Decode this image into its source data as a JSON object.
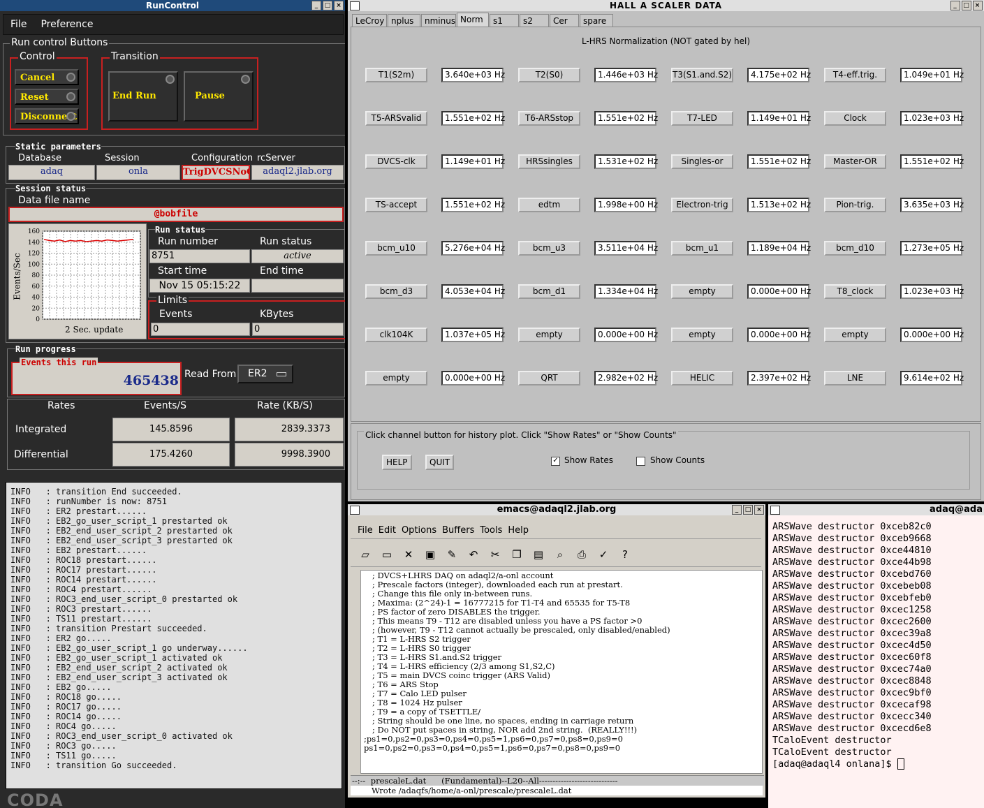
{
  "runcontrol": {
    "title": "RunControl",
    "menu": [
      "File",
      "Preference"
    ],
    "run_control_buttons": "Run control Buttons",
    "control_label": "Control",
    "control_buttons": [
      "Cancel",
      "Reset",
      "Disconnect"
    ],
    "transition_label": "Transition",
    "transition_buttons": [
      "End Run",
      "Pause"
    ],
    "static_params": {
      "title": "Static parameters",
      "database_label": "Database",
      "database": "adaq",
      "session_label": "Session",
      "session": "onla",
      "config_label": "Configuration",
      "config": "TrigDVCSNoC",
      "rcserver_label": "rcServer",
      "rcserver": "adaql2.jlab.org"
    },
    "session_status": {
      "title": "Session status",
      "data_file_label": "Data file name",
      "data_file": "@bobfile"
    },
    "plot": {
      "ylabel": "Events/Sec",
      "xlabel": "2 Sec. update",
      "y_ticks": [
        "160",
        "140",
        "120",
        "100",
        "80",
        "60",
        "40",
        "20",
        "0"
      ],
      "ylim": [
        0,
        160
      ],
      "series_values": [
        145,
        143,
        142,
        144,
        141,
        143,
        142,
        143,
        141,
        142,
        143,
        142,
        144,
        143,
        142,
        143,
        144,
        145
      ]
    },
    "run_status": {
      "title": "Run status",
      "run_number_label": "Run number",
      "run_number": "8751",
      "run_status_label": "Run status",
      "run_status": "active",
      "start_time_label": "Start time",
      "start_time": "Nov 15 05:15:22",
      "end_time_label": "End time",
      "end_time": "",
      "limits_label": "Limits",
      "events_label": "Events",
      "events": "0",
      "kbytes_label": "KBytes",
      "kbytes": "0"
    },
    "run_progress": {
      "title": "Run progress",
      "events_label": "Events this run",
      "events": "465438",
      "read_from_label": "Read From:",
      "read_from": "ER2"
    },
    "rates": {
      "rates_label": "Rates",
      "events_label": "Events/S",
      "rate_label": "Rate (KB/S)",
      "integrated_label": "Integrated",
      "integrated_events": "145.8596",
      "integrated_rate": "2839.3373",
      "differential_label": "Differential",
      "differential_events": "175.4260",
      "differential_rate": "9998.3900"
    },
    "log": [
      "INFO   : transition End succeeded.",
      "INFO   : runNumber is now: 8751",
      "INFO   : ER2 prestart......",
      "INFO   : EB2_go_user_script_1 prestarted ok",
      "INFO   : EB2_end_user_script_2 prestarted ok",
      "INFO   : EB2_end_user_script_3 prestarted ok",
      "INFO   : EB2 prestart......",
      "INFO   : ROC18 prestart......",
      "INFO   : ROC17 prestart......",
      "INFO   : ROC14 prestart......",
      "INFO   : ROC4 prestart......",
      "INFO   : ROC3_end_user_script_0 prestarted ok",
      "INFO   : ROC3 prestart......",
      "INFO   : TS11 prestart......",
      "INFO   : transition Prestart succeeded.",
      "INFO   : ER2 go.....",
      "INFO   : EB2_go_user_script_1 go underway......",
      "INFO   : EB2_go_user_script_1 activated ok",
      "INFO   : EB2_end_user_script_2 activated ok",
      "INFO   : EB2_end_user_script_3 activated ok",
      "INFO   : EB2 go.....",
      "INFO   : ROC18 go.....",
      "INFO   : ROC17 go.....",
      "INFO   : ROC14 go.....",
      "INFO   : ROC4 go.....",
      "INFO   : ROC3_end_user_script_0 activated ok",
      "INFO   : ROC3 go.....",
      "INFO   : TS11 go.....",
      "INFO   : transition Go succeeded."
    ],
    "logo": "CODA"
  },
  "scaler": {
    "title": "HALL  A  SCALER  DATA",
    "tabs": [
      "LeCroy",
      "nplus",
      "nminus",
      "Norm",
      "s1",
      "s2",
      "Cer",
      "spare"
    ],
    "selected_tab": "Norm",
    "heading": "L-HRS Normalization (NOT gated by hel)",
    "rows": [
      [
        [
          "T1(S2m)",
          "3.640e+03 Hz"
        ],
        [
          "T2(S0)",
          "1.446e+03 Hz"
        ],
        [
          "T3(S1.and.S2)",
          "4.175e+02 Hz"
        ],
        [
          "T4-eff.trig.",
          "1.049e+01 Hz"
        ]
      ],
      [
        [
          "T5-ARSvalid",
          "1.551e+02 Hz"
        ],
        [
          "T6-ARSstop",
          "1.551e+02 Hz"
        ],
        [
          "T7-LED",
          "1.149e+01 Hz"
        ],
        [
          "Clock",
          "1.023e+03 Hz"
        ]
      ],
      [
        [
          "DVCS-clk",
          "1.149e+01 Hz"
        ],
        [
          "HRSsingles",
          "1.531e+02 Hz"
        ],
        [
          "Singles-or",
          "1.551e+02 Hz"
        ],
        [
          "Master-OR",
          "1.551e+02 Hz"
        ]
      ],
      [
        [
          "TS-accept",
          "1.551e+02 Hz"
        ],
        [
          "edtm",
          "1.998e+00 Hz"
        ],
        [
          "Electron-trig",
          "1.513e+02 Hz"
        ],
        [
          "Pion-trig.",
          "3.635e+03 Hz"
        ]
      ],
      [
        [
          "bcm_u10",
          "5.276e+04 Hz"
        ],
        [
          "bcm_u3",
          "3.511e+04 Hz"
        ],
        [
          "bcm_u1",
          "1.189e+04 Hz"
        ],
        [
          "bcm_d10",
          "1.273e+05 Hz"
        ]
      ],
      [
        [
          "bcm_d3",
          "4.053e+04 Hz"
        ],
        [
          "bcm_d1",
          "1.334e+04 Hz"
        ],
        [
          "empty",
          "0.000e+00 Hz"
        ],
        [
          "T8_clock",
          "1.023e+03 Hz"
        ]
      ],
      [
        [
          "clk104K",
          "1.037e+05 Hz"
        ],
        [
          "empty",
          "0.000e+00 Hz"
        ],
        [
          "empty",
          "0.000e+00 Hz"
        ],
        [
          "empty",
          "0.000e+00 Hz"
        ]
      ],
      [
        [
          "empty",
          "0.000e+00 Hz"
        ],
        [
          "QRT",
          "2.982e+02 Hz"
        ],
        [
          "HELIC",
          "2.397e+02 Hz"
        ],
        [
          "LNE",
          "9.614e+02 Hz"
        ]
      ]
    ],
    "footer_text": "Click channel button for history plot.  Click \"Show Rates\" or \"Show Counts\"",
    "help_label": "HELP",
    "quit_label": "QUIT",
    "show_rates_label": "Show Rates",
    "show_rates_checked": true,
    "show_counts_label": "Show Counts",
    "show_counts_checked": false
  },
  "emacs": {
    "title": "emacs@adaql2.jlab.org",
    "menu": [
      "File",
      "Edit",
      "Options",
      "Buffers",
      "Tools",
      "Help"
    ],
    "lines": [
      "; DVCS+LHRS DAQ on adaql2/a-onl account",
      "; Prescale factors (integer), downloaded each run at prestart.",
      "; Change this file only in-between runs.",
      "; Maxima: (2^24)-1 = 16777215 for T1-T4 and 65535 for T5-T8",
      "; PS factor of zero DISABLES the trigger.",
      "; This means T9 - T12 are disabled unless you have a PS factor >0",
      "; (however, T9 - T12 cannot actually be prescaled, only disabled/enabled)",
      "; T1 = L-HRS S2 trigger",
      "; T2 = L-HRS S0 trigger",
      "; T3 = L-HRS S1.and.S2 trigger",
      "; T4 = L-HRS efficiency (2/3 among S1,S2,C)",
      "; T5 = main DVCS coinc trigger (ARS Valid)",
      "; T6 = ARS Stop",
      "; T7 = Calo LED pulser",
      "; T8 = 1024 Hz pulser",
      "; T9 = a copy of TSETTLE/",
      "; String should be one line, no spaces, ending in carriage return",
      "; Do NOT put spaces in string, NOR add 2nd string.  (REALLY!!!)",
      ";ps1=0,ps2=0,ps3=0,ps4=0,ps5=1,ps6=0,ps7=0,ps8=0,ps9=0",
      "ps1=0,ps2=0,ps3=0,ps4=0,ps5=1,ps6=0,ps7=0,ps8=0,ps9=0"
    ],
    "modeline": "--:--  prescaleL.dat      (Fundamental)--L20--All-----------------------------",
    "minibuffer": "Wrote /adaqfs/home/a-onl/prescale/prescaleL.dat"
  },
  "xterm": {
    "title": "adaq@ada",
    "lines": [
      "ARSWave destructor 0xceb82c0",
      "ARSWave destructor 0xceb9668",
      "ARSWave destructor 0xce44810",
      "ARSWave destructor 0xce44b98",
      "ARSWave destructor 0xcebd760",
      "ARSWave destructor 0xcebeb08",
      "ARSWave destructor 0xcebfeb0",
      "ARSWave destructor 0xcec1258",
      "ARSWave destructor 0xcec2600",
      "ARSWave destructor 0xcec39a8",
      "ARSWave destructor 0xcec4d50",
      "ARSWave destructor 0xcec60f8",
      "ARSWave destructor 0xcec74a0",
      "ARSWave destructor 0xcec8848",
      "ARSWave destructor 0xcec9bf0",
      "ARSWave destructor 0xcecaf98",
      "ARSWave destructor 0xcecc340",
      "ARSWave destructor 0xcecd6e8",
      "TCaloEvent destructor",
      "TCaloEvent destructor",
      "[adaq@adaql4 onlana]$ "
    ]
  }
}
